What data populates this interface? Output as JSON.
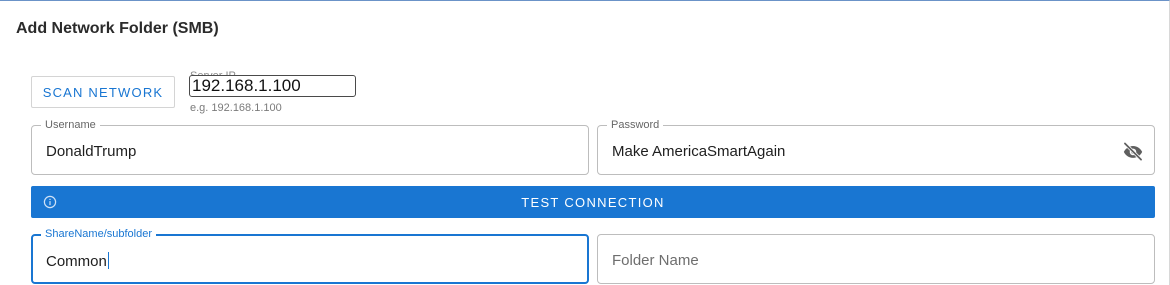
{
  "dialog": {
    "title": "Add Network Folder (SMB)"
  },
  "scan": {
    "label": "SCAN NETWORK"
  },
  "server": {
    "label": "Server IP",
    "value": "192.168.1.100",
    "hint": "e.g. 192.168.1.100"
  },
  "username": {
    "label": "Username",
    "value": "DonaldTrump"
  },
  "password": {
    "label": "Password",
    "value": "Make AmericaSmartAgain",
    "visibility_icon": "eye-off-icon"
  },
  "test": {
    "label": "TEST CONNECTION",
    "icon": "info-icon"
  },
  "share": {
    "label": "ShareName/subfolder",
    "value": "Common"
  },
  "folder": {
    "placeholder": "Folder Name"
  },
  "colors": {
    "accent": "#1976d2",
    "border": "#bdbdbd",
    "text": "#1e1e1e"
  }
}
